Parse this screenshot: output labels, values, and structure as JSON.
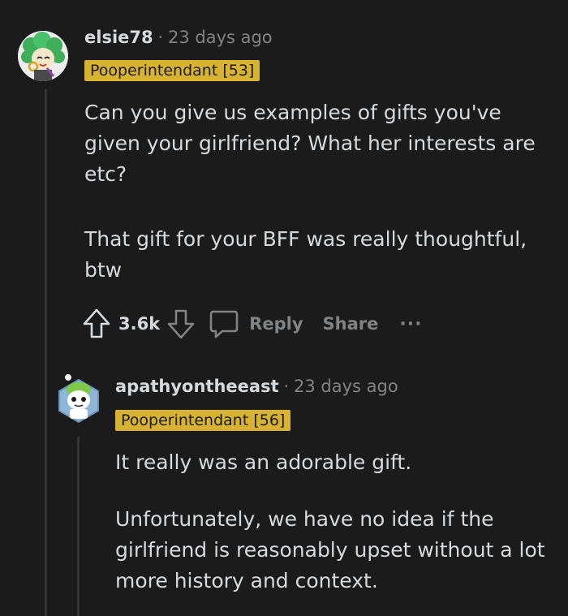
{
  "comment1": {
    "username": "elsie78",
    "separator": "·",
    "timestamp": "23 days ago",
    "flair": "Pooperintendant [53]",
    "paragraphs": [
      "Can you give us examples of gifts you've given your girlfriend? What her interests are etc?",
      "That gift for your BFF was really thoughtful, btw"
    ],
    "score": "3.6k",
    "reply_label": "Reply",
    "share_label": "Share",
    "more_label": "···"
  },
  "comment2": {
    "username": "apathyontheeast",
    "separator": "·",
    "timestamp": "23 days ago",
    "flair": "Pooperintendant [56]",
    "paragraphs": [
      "It really was an adorable gift.",
      "Unfortunately, we have no idea if the girlfriend is reasonably upset without a lot more history and context."
    ]
  },
  "colors": {
    "background": "#1b1b1b",
    "flair": "#d8b332",
    "text": "#d7dadc",
    "muted": "#818384"
  },
  "icons": [
    "upvote-icon",
    "downvote-icon",
    "comment-bubble-icon",
    "more-options-icon"
  ]
}
